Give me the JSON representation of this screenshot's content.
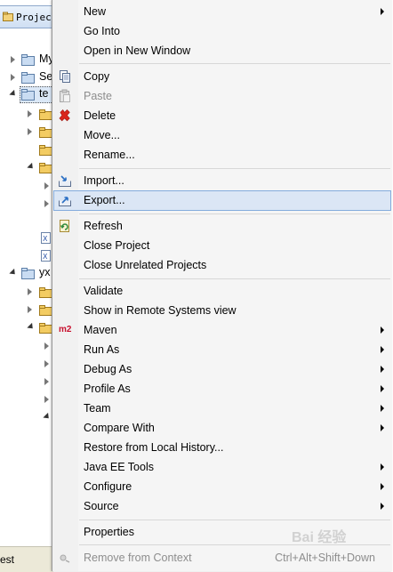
{
  "explorer": {
    "tab_title": "Project",
    "visible_labels": [
      "My",
      "Se",
      "te",
      "yx"
    ],
    "status_text": "est"
  },
  "menu": {
    "items": [
      {
        "label": "New",
        "submenu": true
      },
      {
        "label": "Go Into"
      },
      {
        "label": "Open in New Window"
      },
      {
        "label": "Copy",
        "icon": "copy-icon"
      },
      {
        "label": "Paste",
        "icon": "paste-icon",
        "disabled": true
      },
      {
        "label": "Delete",
        "icon": "delete-icon"
      },
      {
        "label": "Move..."
      },
      {
        "label": "Rename..."
      },
      {
        "label": "Import...",
        "icon": "import-icon"
      },
      {
        "label": "Export...",
        "icon": "export-icon",
        "highlighted": true
      },
      {
        "label": "Refresh",
        "icon": "refresh-icon"
      },
      {
        "label": "Close Project"
      },
      {
        "label": "Close Unrelated Projects"
      },
      {
        "label": "Validate"
      },
      {
        "label": "Show in Remote Systems view"
      },
      {
        "label": "Maven",
        "icon": "maven-m2-icon",
        "icon_text": "m2",
        "submenu": true
      },
      {
        "label": "Run As",
        "submenu": true
      },
      {
        "label": "Debug As",
        "submenu": true
      },
      {
        "label": "Profile As",
        "submenu": true
      },
      {
        "label": "Team",
        "submenu": true
      },
      {
        "label": "Compare With",
        "submenu": true
      },
      {
        "label": "Restore from Local History..."
      },
      {
        "label": "Java EE Tools",
        "submenu": true
      },
      {
        "label": "Configure",
        "submenu": true
      },
      {
        "label": "Source",
        "submenu": true
      },
      {
        "label": "Properties"
      },
      {
        "label": "Remove from Context",
        "icon": "remove-context-icon",
        "disabled": true,
        "accelerator": "Ctrl+Alt+Shift+Down"
      }
    ]
  },
  "watermark": "Bai 经验",
  "colors": {
    "menu_bg": "#f5f5f5",
    "highlight_bg": "#dbe6f5",
    "highlight_border": "#84acdd",
    "disabled_text": "#8d8d8d",
    "delete_red": "#d9261c",
    "maven_red": "#c8102e"
  }
}
